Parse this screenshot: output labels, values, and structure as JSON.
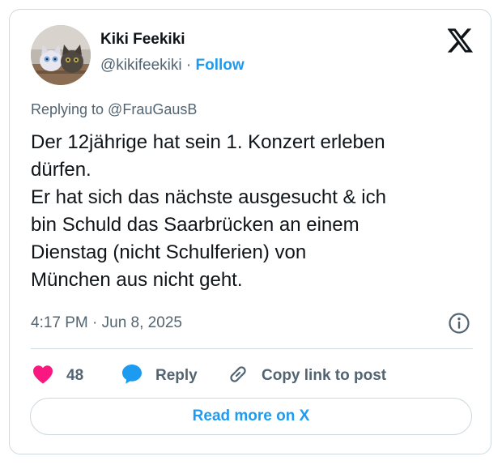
{
  "author": {
    "name": "Kiki Feekiki",
    "handle": "@kikifeekiki",
    "separator": "·",
    "follow_label": "Follow",
    "avatar_icon": "cats-avatar-photo"
  },
  "platform_icon": "x-logo-icon",
  "reply_to": "Replying to @FrauGausB",
  "tweet": {
    "lines": [
      "Der 12jährige hat sein 1. Konzert erleben",
      "dürfen.",
      "Er hat sich das nächste ausgesucht & ich",
      "bin Schuld das Saarbrücken an einem",
      "Dienstag (nicht Schulferien) von",
      "München aus nicht geht."
    ]
  },
  "timestamp": "4:17 PM · Jun 8, 2025",
  "actions": {
    "like_count": "48",
    "reply_label": "Reply",
    "copy_label": "Copy link to post"
  },
  "read_more_label": "Read more on X",
  "colors": {
    "accent": "#1d9bf0",
    "like": "#f91880",
    "text": "#0f1419",
    "muted": "#536471",
    "border": "#cfd9de"
  }
}
